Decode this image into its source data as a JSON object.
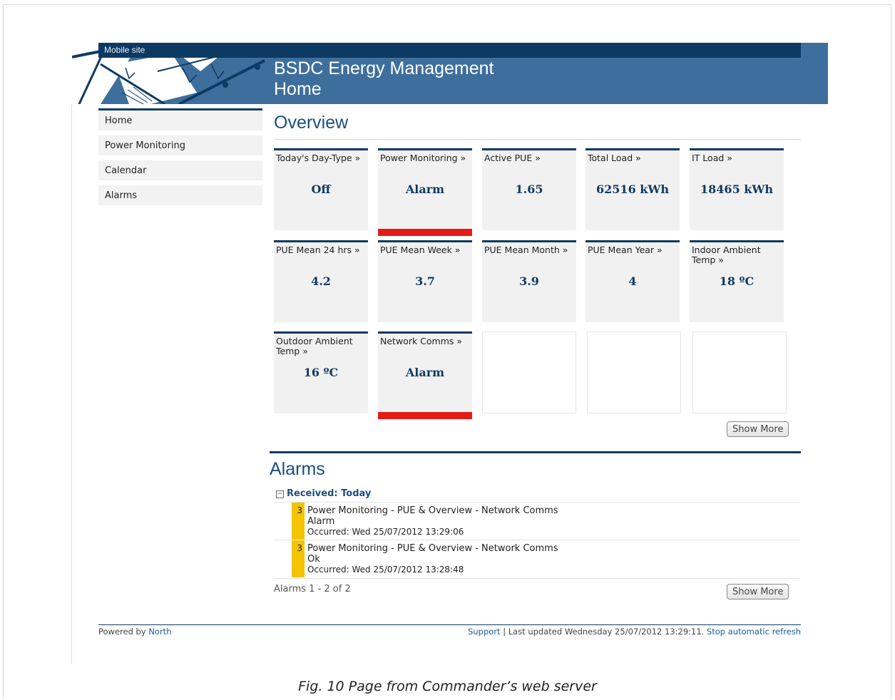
{
  "header": {
    "mobile_link": "Mobile site",
    "title": "BSDC Energy Management",
    "subtitle": "Home"
  },
  "nav": {
    "items": [
      {
        "label": "Home"
      },
      {
        "label": "Power Monitoring"
      },
      {
        "label": "Calendar"
      },
      {
        "label": "Alarms"
      }
    ]
  },
  "overview": {
    "heading": "Overview",
    "tiles": [
      {
        "label": "Today's Day-Type »",
        "value": "Off"
      },
      {
        "label": "Power Monitoring »",
        "value": "Alarm",
        "status_color": "#e41b17"
      },
      {
        "label": "Active PUE »",
        "value": "1.65"
      },
      {
        "label": "Total Load »",
        "value": "62516 kWh"
      },
      {
        "label": "IT Load »",
        "value": "18465 kWh"
      },
      {
        "label": "PUE Mean 24 hrs »",
        "value": "4.2"
      },
      {
        "label": "PUE Mean Week »",
        "value": "3.7"
      },
      {
        "label": "PUE Mean Month »",
        "value": "3.9"
      },
      {
        "label": "PUE Mean Year »",
        "value": "4"
      },
      {
        "label": "Indoor Ambient Temp »",
        "value": "18 ºC"
      },
      {
        "label": "Outdoor Ambient Temp »",
        "value": "16 ºC"
      },
      {
        "label": "Network Comms »",
        "value": "Alarm",
        "status_color": "#e41b17"
      }
    ],
    "show_more": "Show More"
  },
  "alarms": {
    "heading": "Alarms",
    "group_label": "Received: Today",
    "rows": [
      {
        "severity": "3",
        "source": "Power Monitoring - PUE & Overview - Network Comms",
        "state": "Alarm",
        "occurred": "Occurred: Wed 25/07/2012 13:29:06"
      },
      {
        "severity": "3",
        "source": "Power Monitoring - PUE & Overview - Network Comms",
        "state": "Ok",
        "occurred": "Occurred: Wed 25/07/2012 13:28:48"
      }
    ],
    "pager": "Alarms 1 - 2 of 2",
    "show_more": "Show More"
  },
  "footer": {
    "powered_prefix": "Powered by ",
    "powered_link": "North",
    "support_link": "Support",
    "separator": " | ",
    "last_updated": "Last updated Wednesday 25/07/2012 13:29:11. ",
    "stop_refresh": "Stop automatic refresh"
  },
  "caption": "Fig. 10 Page from Commander’s web server",
  "colors": {
    "banner": "#3e6f9c",
    "navy": "#0c3a63",
    "alarm_red": "#e41b17",
    "severity_yellow": "#f5c400",
    "link": "#1c5e9c"
  }
}
